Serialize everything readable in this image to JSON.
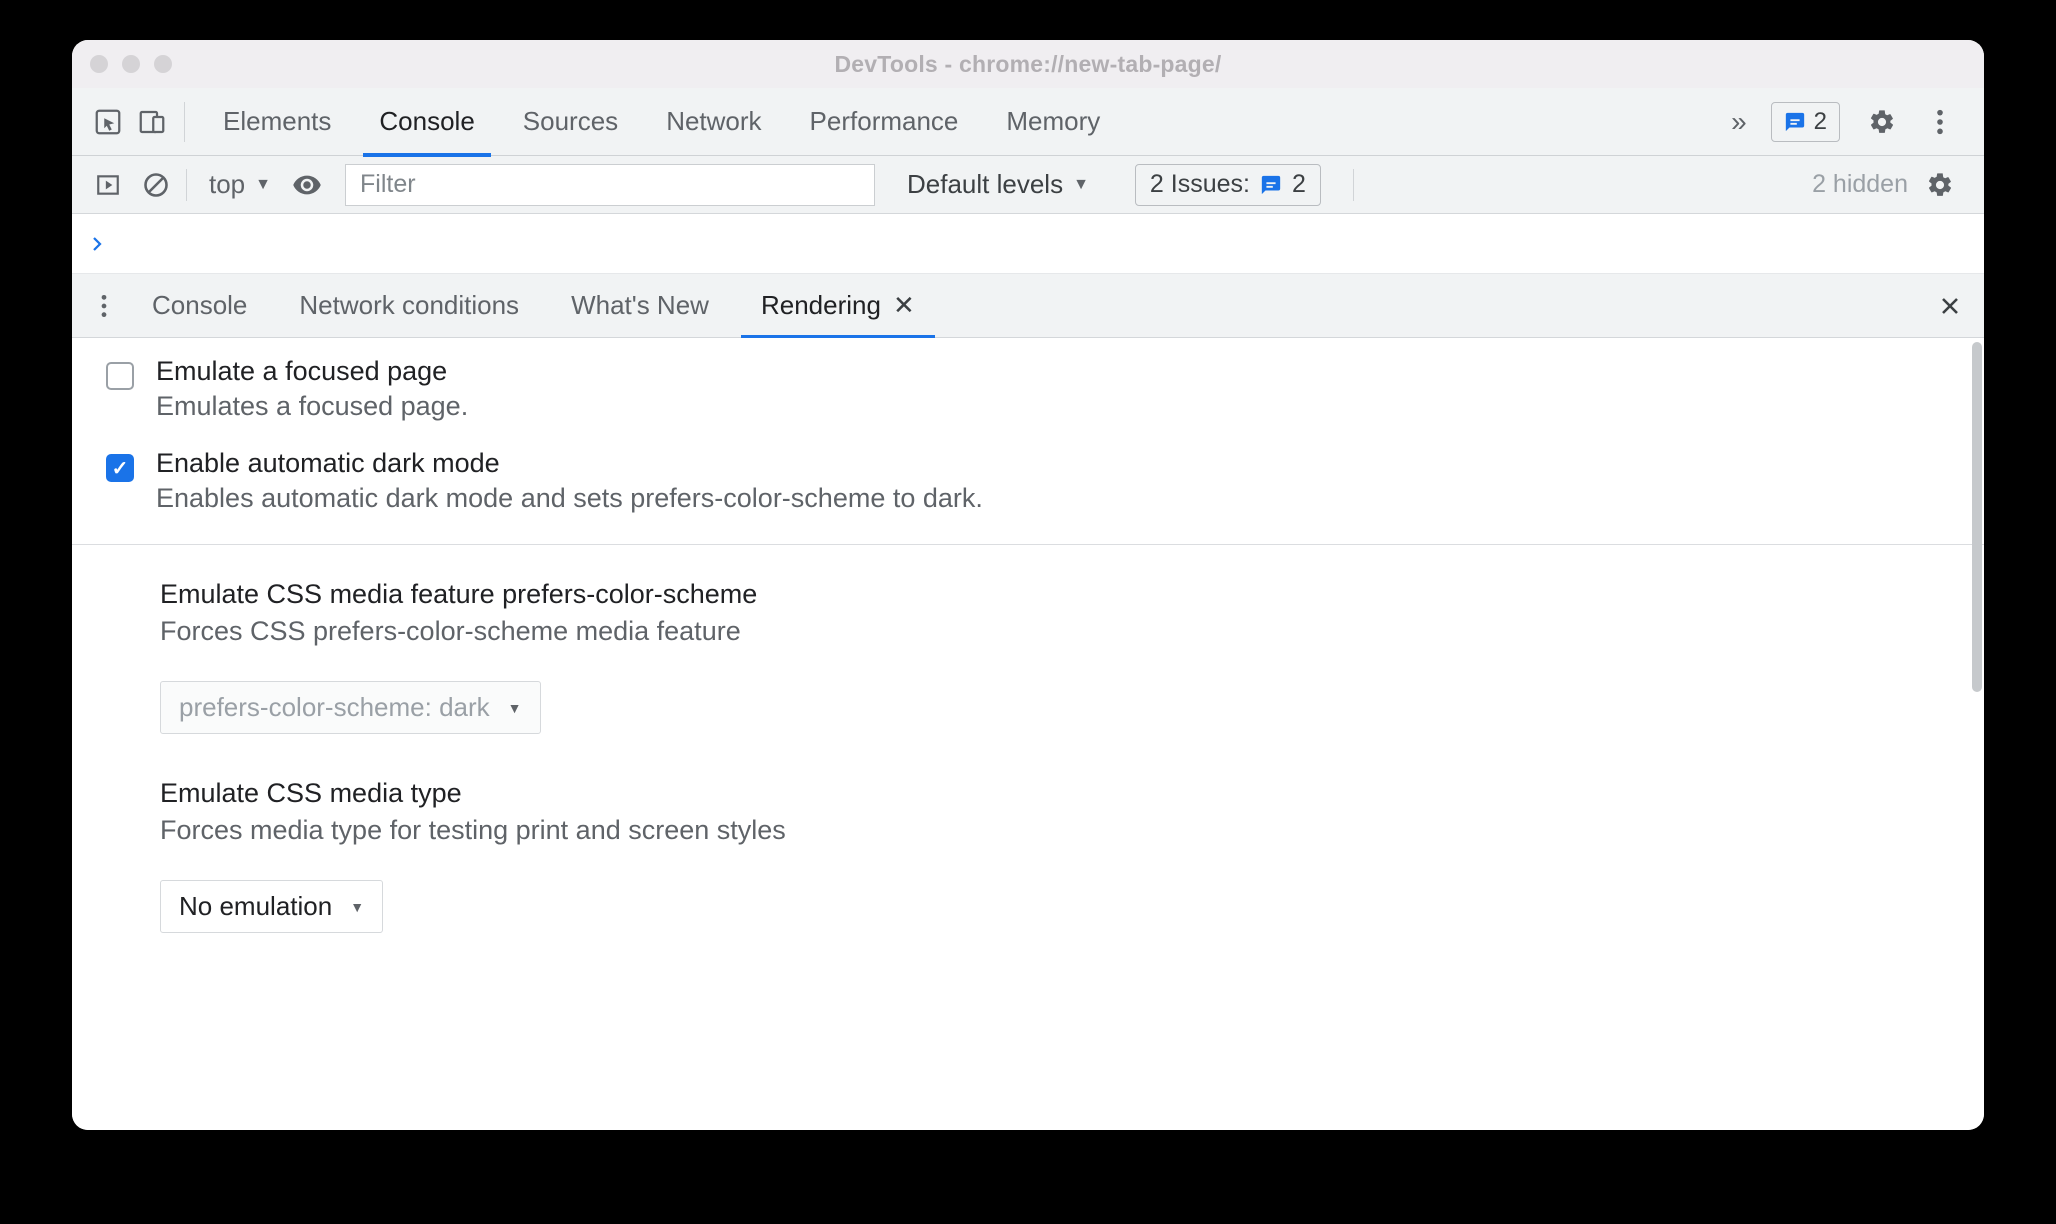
{
  "window": {
    "title": "DevTools - chrome://new-tab-page/"
  },
  "main_tabs": [
    "Elements",
    "Console",
    "Sources",
    "Network",
    "Performance",
    "Memory"
  ],
  "main_tabs_active_index": 1,
  "badge": {
    "count": "2"
  },
  "console_bar": {
    "context": "top",
    "filter_placeholder": "Filter",
    "levels": "Default levels",
    "issues_label": "2 Issues:",
    "issues_count": "2",
    "hidden": "2 hidden"
  },
  "drawer_tabs": {
    "items": [
      "Console",
      "Network conditions",
      "What's New",
      "Rendering"
    ],
    "active_index": 3
  },
  "rendering": {
    "emulate_focused": {
      "title": "Emulate a focused page",
      "desc": "Emulates a focused page.",
      "checked": false
    },
    "auto_dark": {
      "title": "Enable automatic dark mode",
      "desc": "Enables automatic dark mode and sets prefers-color-scheme to dark.",
      "checked": true
    },
    "prefers_scheme": {
      "title": "Emulate CSS media feature prefers-color-scheme",
      "desc": "Forces CSS prefers-color-scheme media feature",
      "value": "prefers-color-scheme: dark"
    },
    "media_type": {
      "title": "Emulate CSS media type",
      "desc": "Forces media type for testing print and screen styles",
      "value": "No emulation"
    }
  }
}
